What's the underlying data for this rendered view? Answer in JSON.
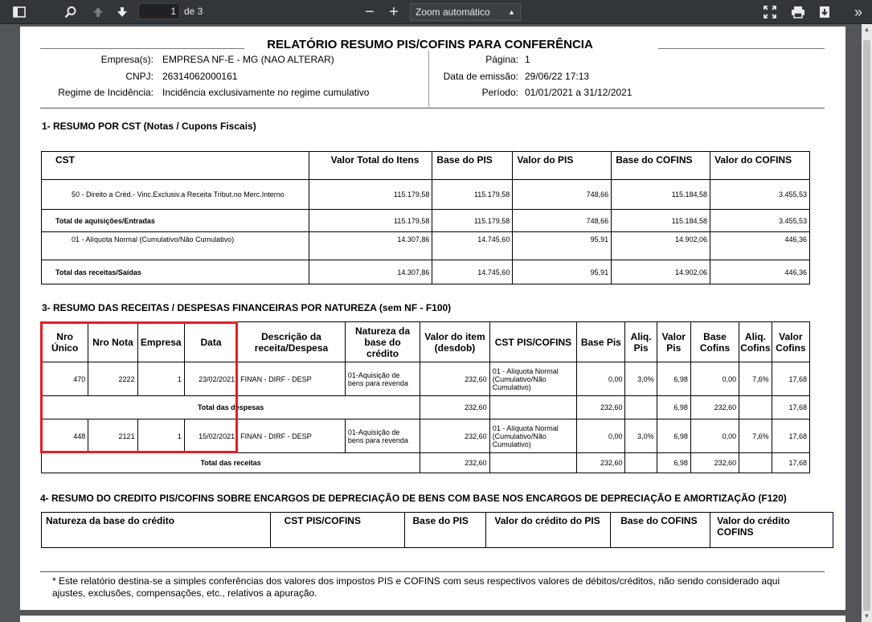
{
  "toolbar": {
    "page_current": "1",
    "page_of": "de 3",
    "zoom_minus": "−",
    "zoom_plus": "+",
    "zoom_label": "Zoom automático",
    "more": "»"
  },
  "report": {
    "title": "RELATÓRIO RESUMO PIS/COFINS PARA CONFERÊNCIA",
    "company_label": "Empresa(s):",
    "company_value": "EMPRESA NF-E - MG (NAO ALTERAR)",
    "cnpj_label": "CNPJ:",
    "cnpj_value": "26314062000161",
    "regime_label": "Regime de Incidência:",
    "regime_value": "Incidência exclusivamente no regime cumulativo",
    "page_label": "Página:",
    "page_value": "1",
    "emission_label": "Data de emissão:",
    "emission_value": "29/06/22 17:13",
    "period_label": "Período:",
    "period_value": "01/01/2021 a 31/12/2021"
  },
  "section1": {
    "title": "1- RESUMO POR CST (Notas / Cupons Fiscais)",
    "headers": [
      "CST",
      "Valor Total do Itens",
      "Base do PIS",
      "Valor do PIS",
      "Base do COFINS",
      "Valor do COFINS"
    ],
    "rows": [
      [
        "50 - Direito a Créd.- Vinc.Exclusiv.a Receita Tribut.no Merc.Interno",
        "115.179,58",
        "115.179,58",
        "748,66",
        "115.184,58",
        "3.455,53"
      ],
      [
        "Total de aquisições/Entradas",
        "115.179,58",
        "115.179,58",
        "748,66",
        "115.184,58",
        "3.455,53"
      ],
      [
        "01 - Alíquota Normal (Cumulativo/Não Cumulativo)",
        "14.307,86",
        "14.745,60",
        "95,91",
        "14.902,06",
        "446,36"
      ],
      [
        "Total das receitas/Saídas",
        "14.307,86",
        "14.745,60",
        "95,91",
        "14.902,06",
        "446,36"
      ]
    ]
  },
  "section3": {
    "title": "3- RESUMO DAS RECEITAS / DESPESAS FINANCEIRAS POR NATUREZA (sem NF - F100)",
    "headers": [
      "Nro Único",
      "Nro Nota",
      "Empresa",
      "Data",
      "Descrição da receita/Despesa",
      "Natureza da base do crédito",
      "Valor do item (desdob)",
      "CST PIS/COFINS",
      "Base Pis",
      "Aliq. Pis",
      "Valor Pis",
      "Base Cofins",
      "Aliq. Cofins",
      "Valor Cofins"
    ],
    "row1": [
      "470",
      "2222",
      "1",
      "23/02/2021",
      "FINAN - DIRF - DESP",
      "01-Aquisição de bens para revenda",
      "232,60",
      "01 - Alíquota Normal (Cumulativo/Não Cumulativo)",
      "0,00",
      "3,0%",
      "6,98",
      "0,00",
      "7,6%",
      "17,68"
    ],
    "total1": [
      "Total das despesas",
      "232,60",
      "232,60",
      "6,98",
      "232,60",
      "17,68"
    ],
    "row2": [
      "448",
      "2121",
      "1",
      "15/02/2021",
      "FINAN - DIRF - DESP",
      "01-Aquisição de bens para revenda",
      "232,60",
      "01 - Alíquota Normal (Cumulativo/Não Cumulativo)",
      "0,00",
      "3,0%",
      "6,98",
      "0,00",
      "7,6%",
      "17,68"
    ],
    "total2": [
      "Total das receitas",
      "232,60",
      "232,60",
      "6,98",
      "232,60",
      "17,68"
    ]
  },
  "section4": {
    "title": "4- RESUMO DO CREDITO PIS/COFINS SOBRE ENCARGOS DE DEPRECIAÇÃO DE BENS COM BASE NOS ENCARGOS DE DEPRECIAÇÃO E AMORTIZAÇÃO (F120)",
    "headers": [
      "Natureza da base do crédito",
      "CST PIS/COFINS",
      "Base do PIS",
      "Valor do crédito do PIS",
      "Base do COFINS",
      "Valor do crédito COFINS"
    ]
  },
  "footnote": "* Este relatório destina-se a simples conferências dos valores dos impostos PIS e COFINS com seus respectivos valores de débitos/créditos, não sendo considerado aqui ajustes, exclusões, compensações, etc., relativos a apuração.",
  "colors": {
    "highlight": "#e31e24",
    "toolbar": "#323639",
    "viewer_bg": "#525659"
  }
}
